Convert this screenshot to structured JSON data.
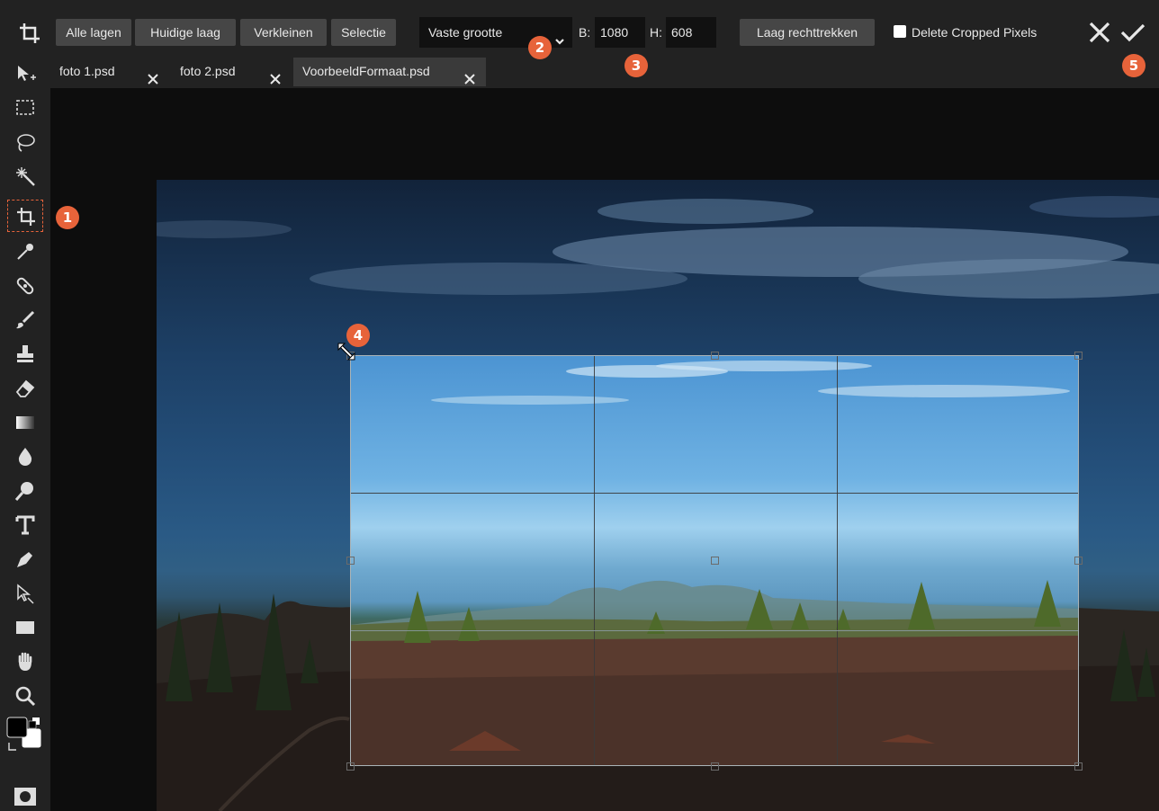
{
  "topbar": {
    "buttons": [
      {
        "label": "Alle lagen"
      },
      {
        "label": "Huidige laag"
      },
      {
        "label": "Verkleinen"
      },
      {
        "label": "Selectie"
      }
    ],
    "mode_select": {
      "value": "Vaste grootte"
    },
    "width": {
      "label": "B:",
      "value": "1080"
    },
    "height": {
      "label": "H:",
      "value": "608"
    },
    "straighten_label": "Laag rechttrekken",
    "delete_cropped": {
      "label": "Delete Cropped Pixels",
      "checked": false
    }
  },
  "tabs": [
    {
      "label": "foto 1.psd",
      "active": false
    },
    {
      "label": "foto 2.psd",
      "active": false
    },
    {
      "label": "VoorbeeldFormaat.psd",
      "active": true
    }
  ],
  "tools": [
    "move-tool",
    "marquee-tool",
    "lasso-tool",
    "magic-wand-tool",
    "crop-tool",
    "eyedropper-tool",
    "healing-tool",
    "brush-tool",
    "stamp-tool",
    "eraser-tool",
    "gradient-tool",
    "blur-tool",
    "dodge-tool",
    "type-tool",
    "pen-tool",
    "path-select-tool",
    "shape-tool",
    "hand-tool",
    "zoom-tool"
  ],
  "active_tool": "crop-tool",
  "colors": {
    "accent": "#e7633a",
    "foreground": "#000000",
    "background": "#ffffff"
  },
  "callouts": {
    "c1": "1",
    "c2": "2",
    "c3": "3",
    "c4": "4",
    "c5": "5"
  }
}
